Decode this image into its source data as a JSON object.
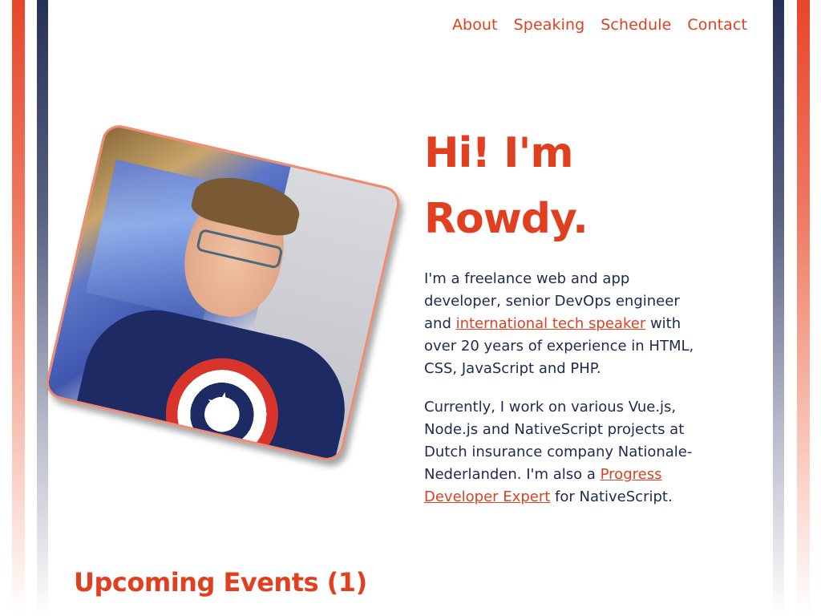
{
  "nav": {
    "items": [
      {
        "label": "About"
      },
      {
        "label": "Speaking"
      },
      {
        "label": "Schedule"
      },
      {
        "label": "Contact"
      }
    ]
  },
  "hero": {
    "heading_line1": "Hi! I'm",
    "heading_line2": "Rowdy.",
    "p1_before": "I'm a freelance web and app developer, senior DevOps engineer and ",
    "p1_link": "international tech speaker",
    "p1_after": " with over 20 years of experience in HTML, CSS, JavaScript and PHP.",
    "p2_before": "Currently, I work on various Vue.js, Node.js and NativeScript projects at Dutch insurance company Nationale-Nederlanden. I'm also a ",
    "p2_link": "Progress Developer Expert",
    "p2_after": " for NativeScript."
  },
  "events": {
    "heading": "Upcoming Events (1)"
  },
  "colors": {
    "accent": "#e0401f",
    "text": "#1f2a4d",
    "navy_stripe": "#263157",
    "orange_stripe": "#e8462a"
  },
  "icons": {
    "shirt_emblem": "star-icon"
  }
}
